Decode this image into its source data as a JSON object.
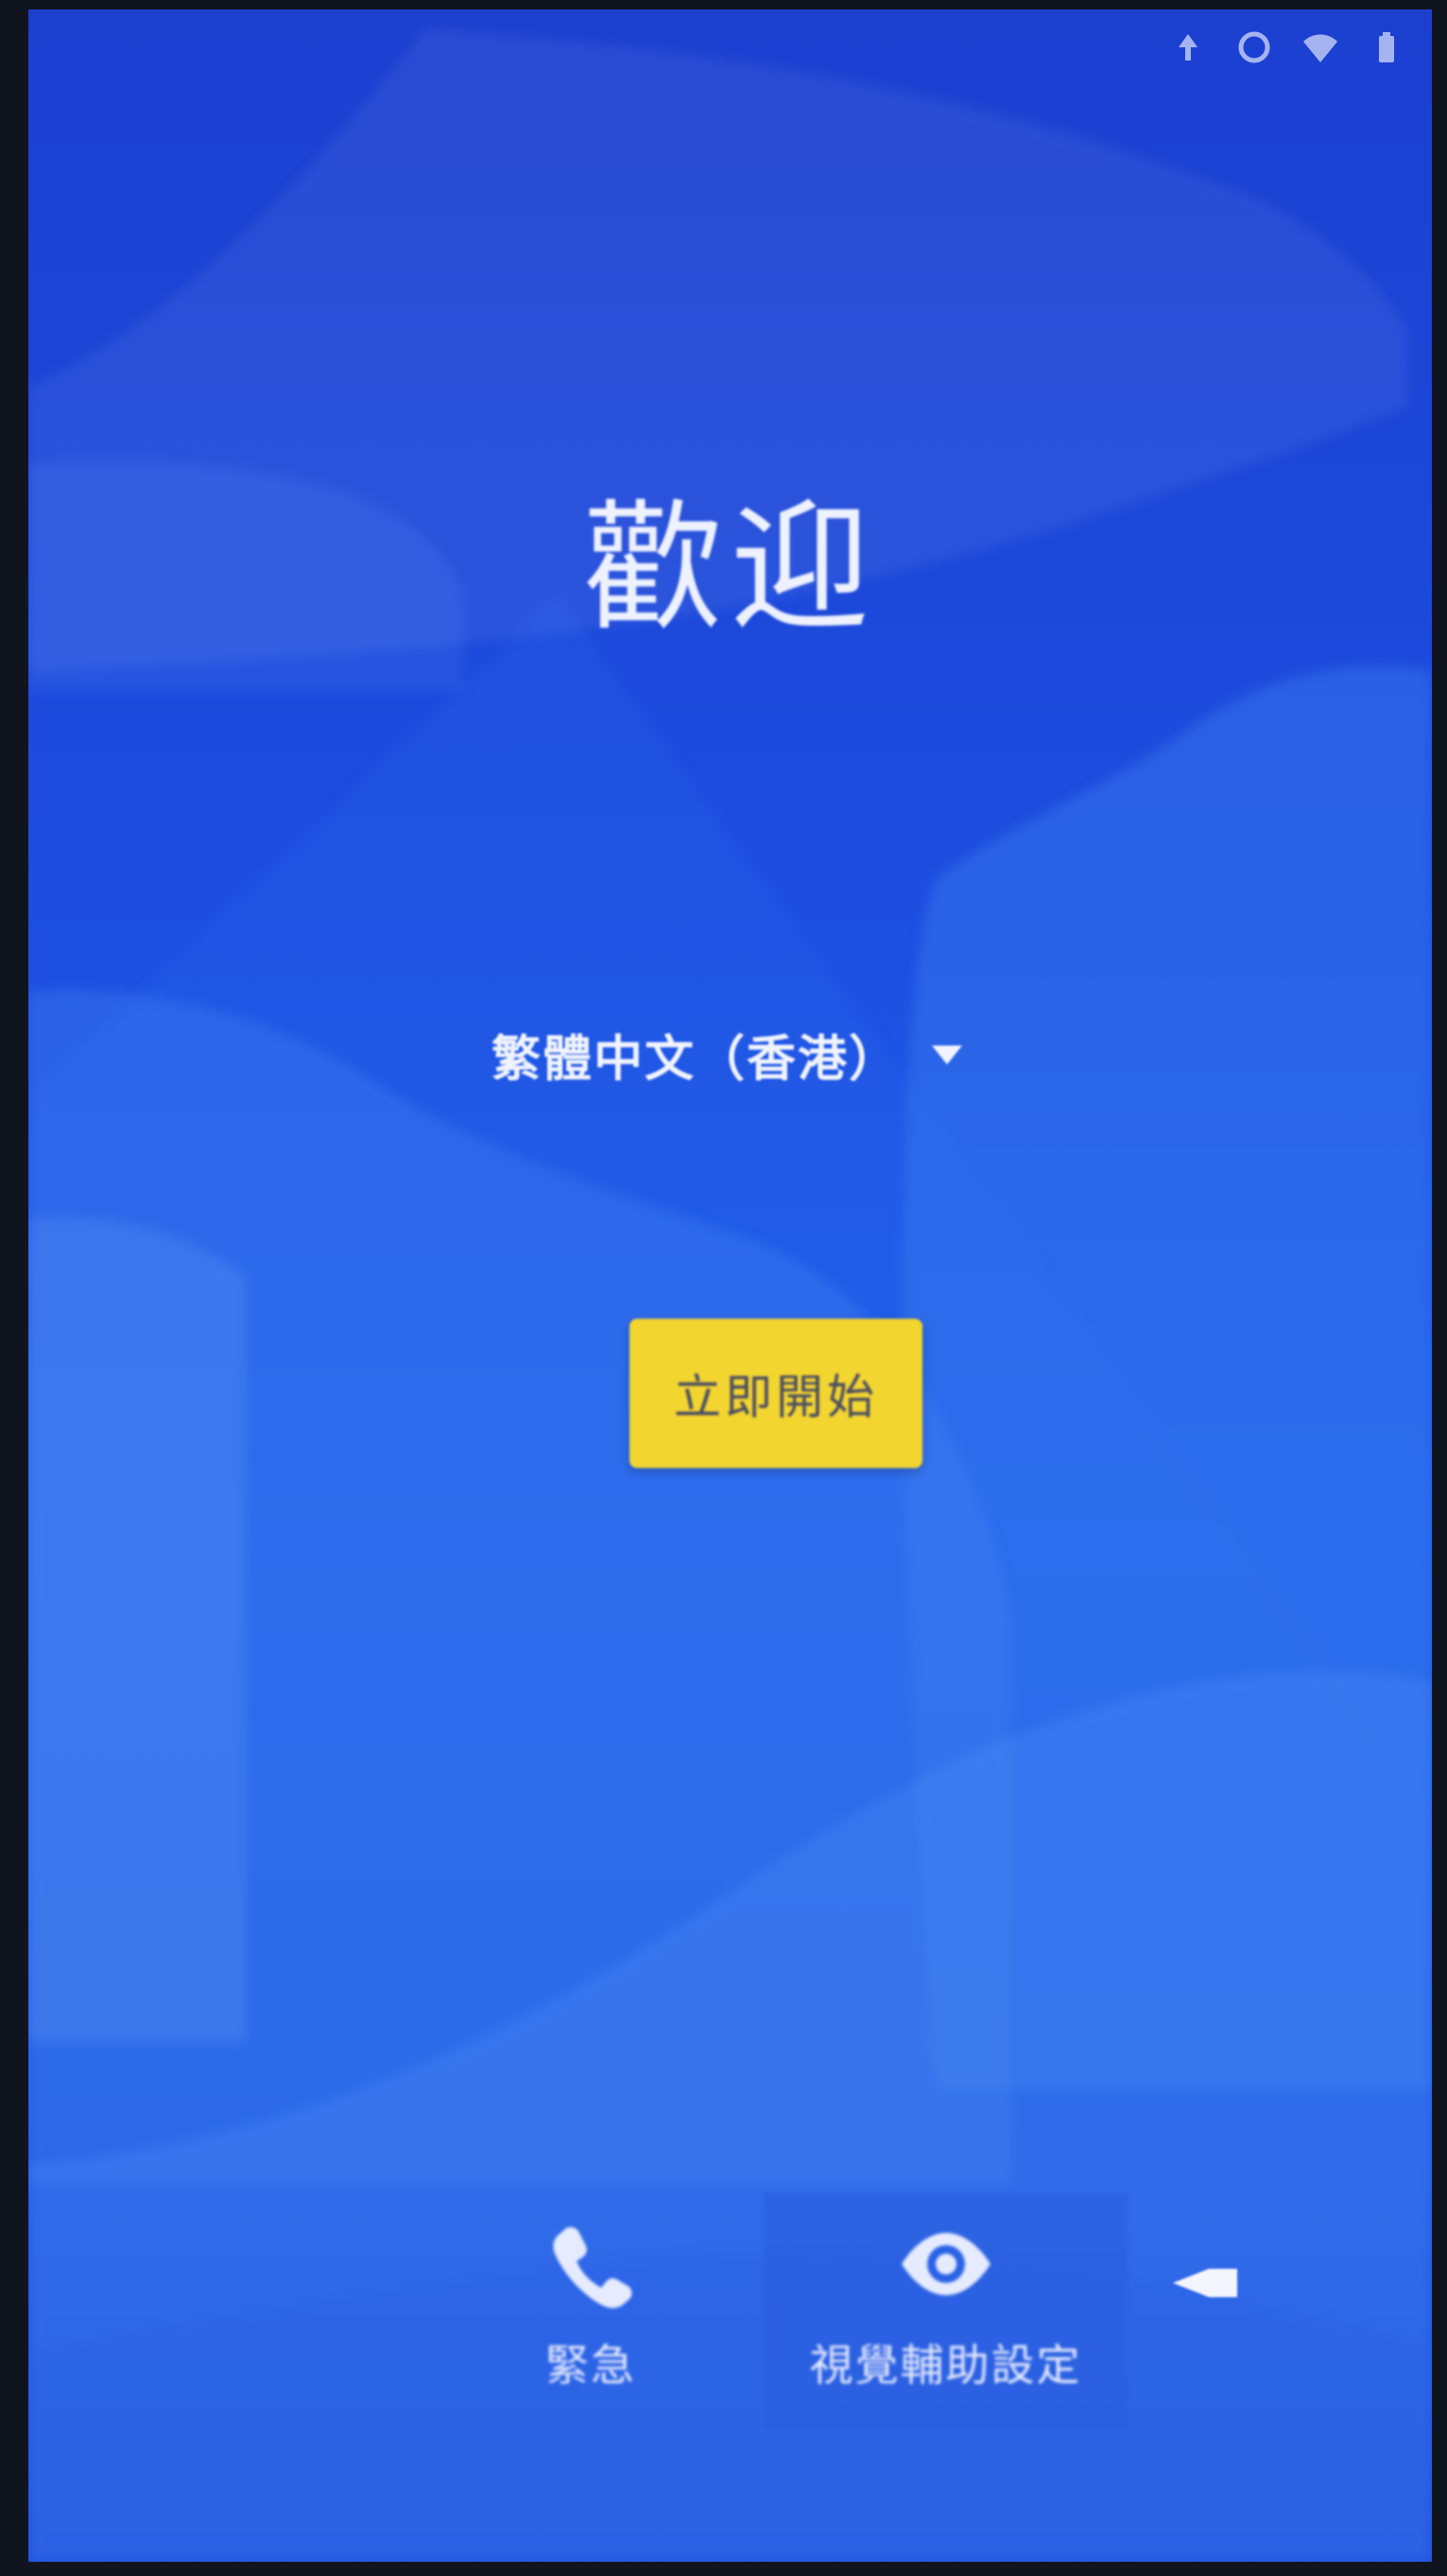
{
  "welcome": {
    "title": "歡迎"
  },
  "language": {
    "selected": "繁體中文（香港）",
    "icon": "chevron-down-icon"
  },
  "start_button": {
    "label": "立即開始",
    "color": "#f3d530"
  },
  "bottom_actions": [
    {
      "label": "緊急",
      "icon": "phone-icon"
    },
    {
      "label": "視覺輔助設定",
      "icon": "eye-icon"
    }
  ],
  "status_bar": {
    "icons": [
      "data-arrow-icon",
      "record-icon",
      "wifi-icon",
      "battery-icon"
    ]
  },
  "colors": {
    "background": "#1d4ee0",
    "accent": "#f3d530",
    "text": "#f1f4ff"
  }
}
